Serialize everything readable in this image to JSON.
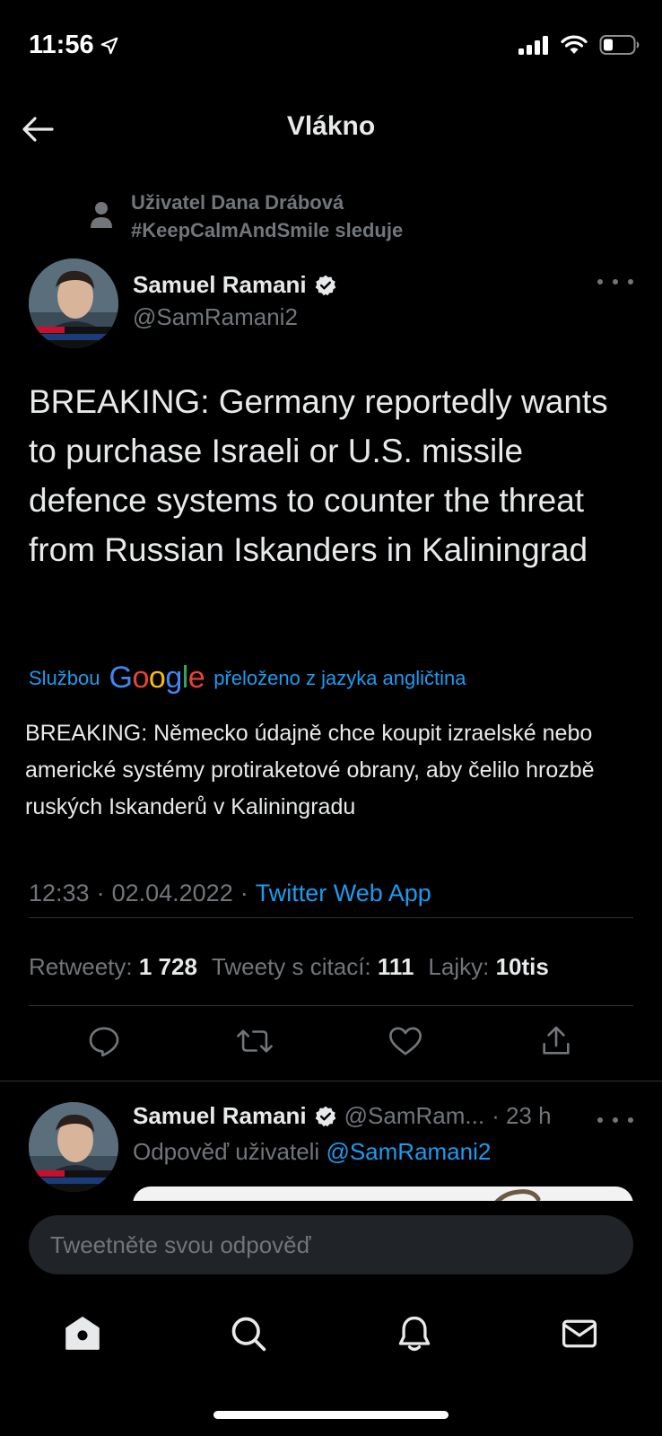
{
  "status_bar": {
    "time": "11:56",
    "location_icon": "location-arrow-icon",
    "signal_icon": "cellular-signal-icon",
    "wifi_icon": "wifi-icon",
    "battery_icon": "battery-icon"
  },
  "header": {
    "title": "Vlákno",
    "back_icon": "arrow-left-icon"
  },
  "social_context": {
    "line1": "Uživatel Dana Drábová",
    "line2": "#KeepCalmAndSmile sleduje"
  },
  "tweet": {
    "author_name": "Samuel Ramani",
    "author_handle": "@SamRamani2",
    "verified": true,
    "text": "BREAKING: Germany reportedly wants to purchase Israeli or U.S. missile defence systems to counter the threat from Russian Iskanders in Kaliningrad",
    "translation_prefix": "Službou",
    "translation_provider": "Google",
    "translation_suffix": "přeloženo z jazyka angličtina",
    "translated_text": "BREAKING: Německo údajně chce koupit izraelské nebo americké systémy protiraketové obrany, aby čelilo hrozbě ruských Iskanderů v Kaliningradu",
    "time": "12:33",
    "date": "02.04.2022",
    "separator": "·",
    "source_app": "Twitter Web App",
    "stats": {
      "retweets_label": "Retweety:",
      "retweets_value": "1 728",
      "quotes_label": "Tweety s citací:",
      "quotes_value": "111",
      "likes_label": "Lajky:",
      "likes_value": "10tis"
    }
  },
  "reply": {
    "author_name": "Samuel Ramani",
    "author_handle": "@SamRam...",
    "time_ago": "· 23 h",
    "reply_to_label": "Odpověď uživateli",
    "reply_to_mention": "@SamRamani2"
  },
  "compose": {
    "placeholder": "Tweetněte svou odpověď"
  },
  "tabbar": {
    "items": [
      "home-icon",
      "search-icon",
      "bell-icon",
      "mail-icon"
    ]
  },
  "colors": {
    "background": "#000000",
    "text_primary": "#e7e9ea",
    "text_secondary": "#71767b",
    "accent": "#1d9bf0",
    "divider": "#2f3336"
  }
}
